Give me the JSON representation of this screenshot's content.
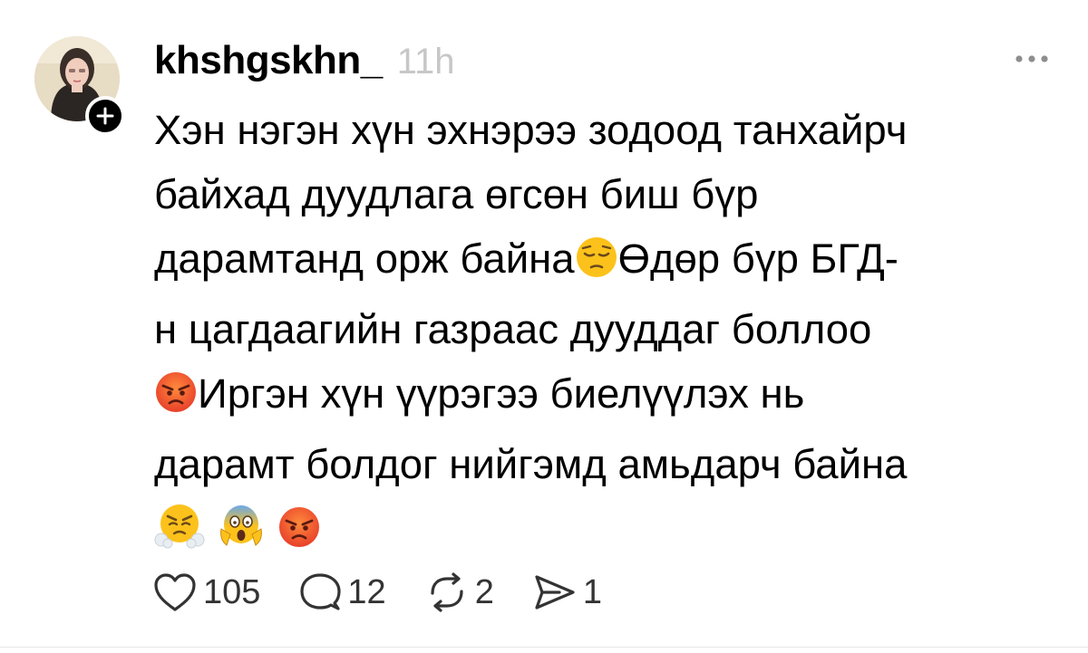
{
  "post": {
    "username": "khshgskhn_",
    "timestamp": "11h",
    "text_lines": [
      "Хэн нэгэн хүн эхнэрээ зодоод танхайрч",
      "байхад дуудлага өгсөн биш бүр",
      "дарамтанд орж байна",
      "Өдөр бүр БГД-",
      "н цагдаагийн газраас дууддаг боллоо",
      "Иргэн хүн үүрэгээ биелүүлэх нь",
      "дарамт болдог нийгэмд амьдарч байна"
    ],
    "emojis": [
      "pensive-face",
      "angry-face",
      "steam-from-nose-face",
      "screaming-face",
      "angry-face"
    ]
  },
  "actions": {
    "likes": "105",
    "replies": "12",
    "reposts": "2",
    "shares": "1"
  },
  "colors": {
    "text": "#000000",
    "timestamp": "#c7c7c7",
    "icon": "#333333",
    "emoji_yellow": "#fcc21b",
    "emoji_red": "#f4502f"
  },
  "icons": [
    "heart-icon",
    "comment-icon",
    "repost-icon",
    "share-icon",
    "more-icon",
    "plus-icon"
  ]
}
